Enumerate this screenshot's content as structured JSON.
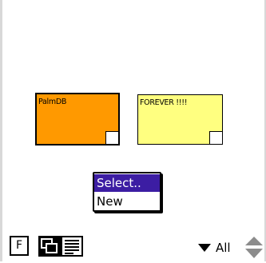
{
  "notes": [
    {
      "title": "PalmDB",
      "color": "#ff9900"
    },
    {
      "title": "FOREVER !!!!",
      "color": "#ffff80"
    }
  ],
  "popup_menu": {
    "items": [
      {
        "label": "Select..",
        "selected": true
      },
      {
        "label": "New",
        "selected": false
      }
    ],
    "highlight_color": "#3c1da3"
  },
  "toolbar": {
    "font_button_label": "F",
    "view_icons": [
      "overlap-view-icon",
      "list-view-icon"
    ],
    "category_label": "All",
    "category_icon": "triangle-down-icon",
    "scroll_icon": "scroll-arrows-icon"
  }
}
